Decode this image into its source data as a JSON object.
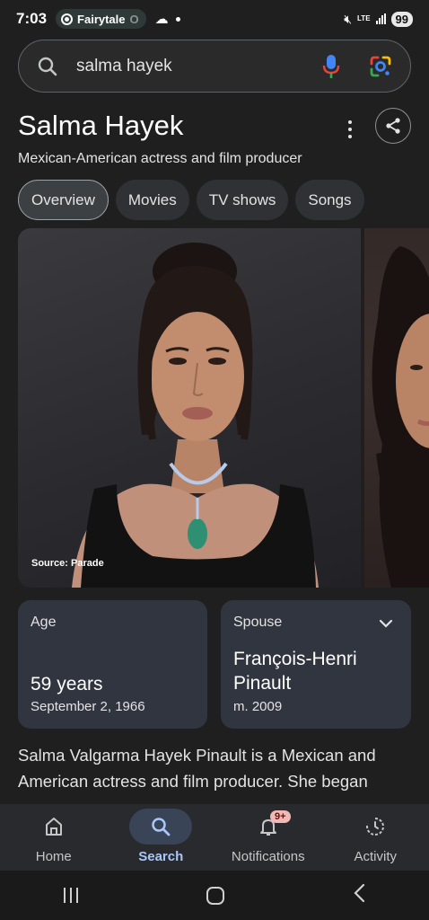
{
  "status_bar": {
    "time": "7:03",
    "app_pill": "Fairytale",
    "app_pill_fade": "O",
    "network": "LTE",
    "battery": "99"
  },
  "search": {
    "query": "salma hayek"
  },
  "entity": {
    "title": "Salma Hayek",
    "subtitle": "Mexican-American actress and film producer"
  },
  "chips": [
    {
      "label": "Overview",
      "active": true
    },
    {
      "label": "Movies",
      "active": false
    },
    {
      "label": "TV shows",
      "active": false
    },
    {
      "label": "Songs",
      "active": false
    }
  ],
  "image": {
    "source": "Source: Parade"
  },
  "cards": {
    "age": {
      "label": "Age",
      "value": "59 years",
      "sub": "September 2, 1966"
    },
    "spouse": {
      "label": "Spouse",
      "value": "François-Henri Pinault",
      "sub": "m. 2009"
    }
  },
  "description": "Salma Valgarma Hayek Pinault is a Mexican and American actress and film producer. She began",
  "bottom_nav": [
    {
      "label": "Home",
      "icon": "home-icon",
      "active": false
    },
    {
      "label": "Search",
      "icon": "search-icon",
      "active": true
    },
    {
      "label": "Notifications",
      "icon": "bell-icon",
      "active": false,
      "badge": "9+"
    },
    {
      "label": "Activity",
      "icon": "activity-icon",
      "active": false
    }
  ],
  "colors": {
    "background": "#1f1f1f",
    "accent": "#a8c7fa",
    "card": "#303540"
  }
}
